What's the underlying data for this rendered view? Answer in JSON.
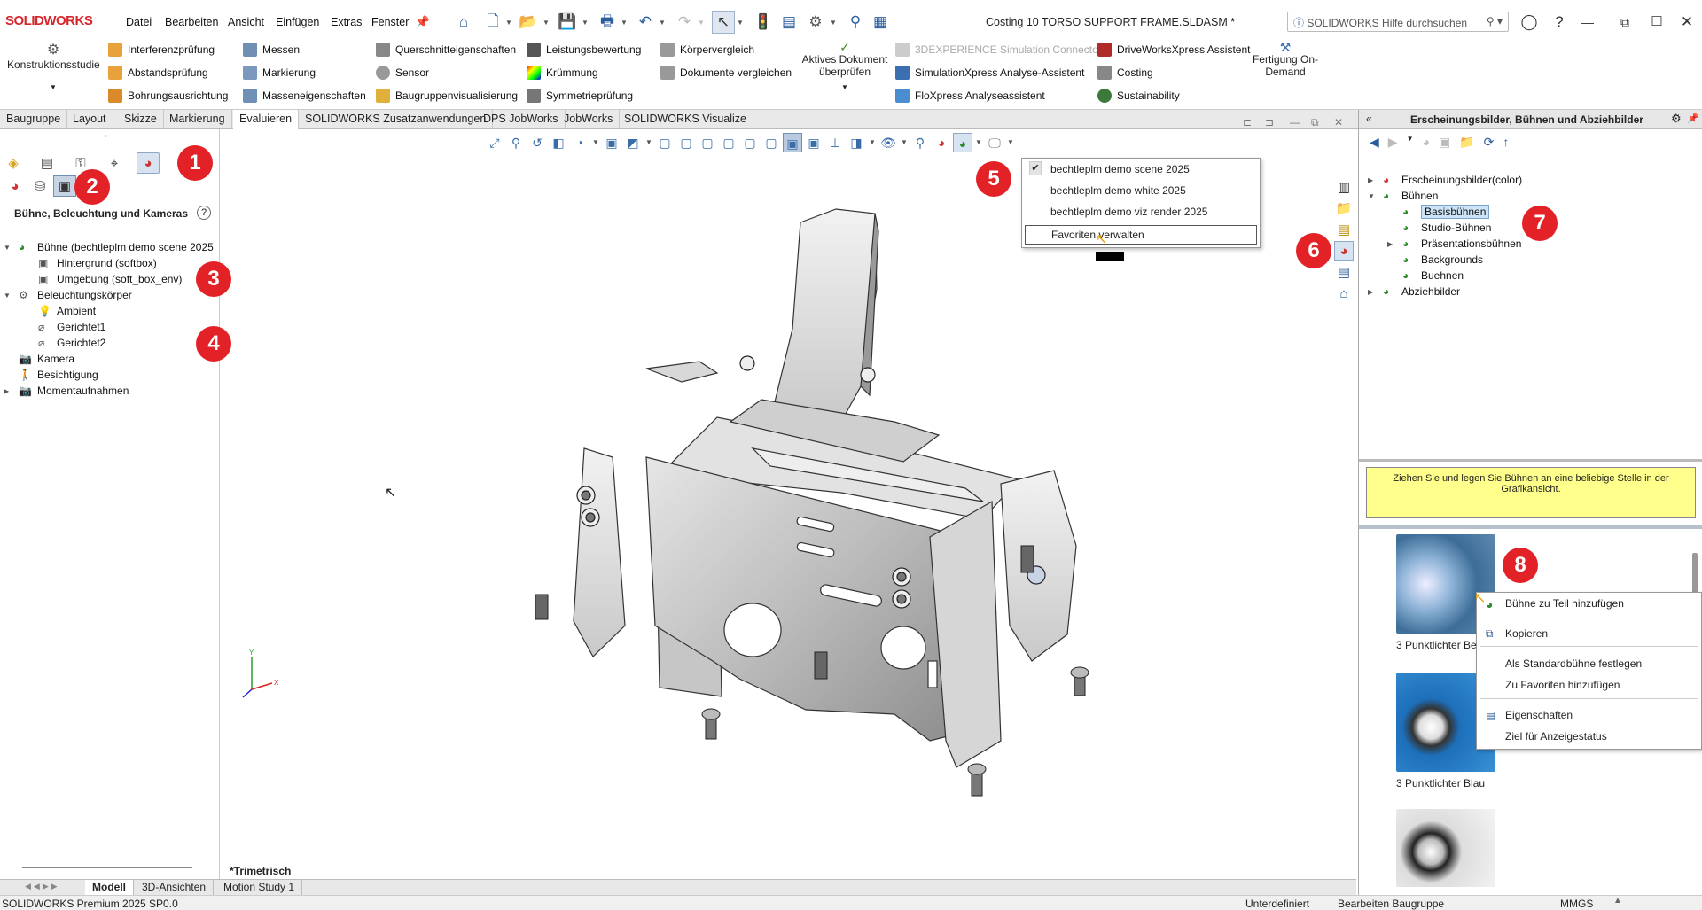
{
  "app": {
    "logo": "SOLIDWORKS",
    "doc_title": "Costing 10 TORSO SUPPORT FRAME.SLDASM *",
    "search_placeholder": "SOLIDWORKS Hilfe durchsuchen"
  },
  "menu": [
    "Datei",
    "Bearbeiten",
    "Ansicht",
    "Einfügen",
    "Extras",
    "Fenster"
  ],
  "ribbon": {
    "konstruktionsstudie": "Konstruktionsstudie",
    "col1": [
      "Interferenzprüfung",
      "Abstandsprüfung",
      "Bohrungsausrichtung"
    ],
    "col2": [
      "Messen",
      "Markierung",
      "Masseneigenschaften"
    ],
    "col3": [
      "Querschnitteigenschaften",
      "Sensor",
      "Baugruppenvisualisierung"
    ],
    "col4": [
      "Leistungsbewertung",
      "Krümmung",
      "Symmetrieprüfung"
    ],
    "col5": [
      "Körpervergleich",
      "Dokumente vergleichen"
    ],
    "aktives": "Aktives Dokument überprüfen",
    "col6": [
      "3DEXPERIENCE Simulation Connector",
      "SimulationXpress Analyse-Assistent",
      "FloXpress Analyseassistent"
    ],
    "col7": [
      "DriveWorksXpress Assistent",
      "Costing",
      "Sustainability"
    ],
    "fertigung": "Fertigung On-Demand"
  },
  "tabs": [
    "Baugruppe",
    "Layout",
    "Skizze",
    "Markierung",
    "Evaluieren",
    "SOLIDWORKS Zusatzanwendungen",
    "DPS JobWorks",
    "JobWorks",
    "SOLIDWORKS Visualize"
  ],
  "left": {
    "title": "Bühne, Beleuchtung und Kameras",
    "tree": [
      {
        "label": "Bühne (bechtleplm demo scene 2025",
        "level": 0,
        "exp": "▼",
        "icon": "scene"
      },
      {
        "label": "Hintergrund (softbox)",
        "level": 1,
        "exp": "",
        "icon": "bg"
      },
      {
        "label": "Umgebung (soft_box_env)",
        "level": 1,
        "exp": "",
        "icon": "env"
      },
      {
        "label": "Beleuchtungskörper",
        "level": 0,
        "exp": "▼",
        "icon": "lights"
      },
      {
        "label": "Ambient",
        "level": 1,
        "exp": "",
        "icon": "bulb"
      },
      {
        "label": "Gerichtet1",
        "level": 1,
        "exp": "",
        "icon": "dir"
      },
      {
        "label": "Gerichtet2",
        "level": 1,
        "exp": "",
        "icon": "dir"
      },
      {
        "label": "Kamera",
        "level": 0,
        "exp": "",
        "icon": "camera"
      },
      {
        "label": "Besichtigung",
        "level": 0,
        "exp": "",
        "icon": "walk"
      },
      {
        "label": "Momentaufnahmen",
        "level": 0,
        "exp": "▶",
        "icon": "snap"
      }
    ]
  },
  "scene_dropdown": [
    "bechtleplm demo scene 2025",
    "bechtleplm demo white 2025",
    "bechtleplm demo viz render 2025",
    "Favoriten verwalten"
  ],
  "view_label": "*Trimetrisch",
  "right": {
    "title": "Erscheinungsbilder, Bühnen und Abziehbilder",
    "tree": [
      {
        "label": "Erscheinungsbilder(color)",
        "level": 0,
        "exp": "▶"
      },
      {
        "label": "Bühnen",
        "level": 0,
        "exp": "▼"
      },
      {
        "label": "Basisbühnen",
        "level": 1,
        "exp": "",
        "selected": true
      },
      {
        "label": "Studio-Bühnen",
        "level": 1,
        "exp": ""
      },
      {
        "label": "Präsentationsbühnen",
        "level": 1,
        "exp": "▶"
      },
      {
        "label": "Backgrounds",
        "level": 1,
        "exp": ""
      },
      {
        "label": "Buehnen",
        "level": 1,
        "exp": ""
      },
      {
        "label": "Abziehbilder",
        "level": 0,
        "exp": "▶"
      }
    ],
    "hint": "Ziehen Sie und legen Sie Bühnen an eine beliebige Stelle in der Grafikansicht.",
    "thumbs": [
      "3 Punktlichter Be",
      "3 Punktlichter Blau",
      ""
    ]
  },
  "context_menu": [
    "Bühne zu Teil hinzufügen",
    "Kopieren",
    "Als Standardbühne festlegen",
    "Zu Favoriten hinzufügen",
    "Eigenschaften",
    "Ziel für Anzeigestatus"
  ],
  "bottom_tabs": [
    "Modell",
    "3D-Ansichten",
    "Motion Study 1"
  ],
  "status": {
    "left": "SOLIDWORKS Premium 2025 SP0.0",
    "s1": "Unterdefiniert",
    "s2": "Bearbeiten Baugruppe",
    "s3": "MMGS"
  },
  "badges": [
    "1",
    "2",
    "3",
    "4",
    "5",
    "6",
    "7",
    "8"
  ],
  "colors": {
    "badge": "#e32227",
    "accent": "#2b5d9a",
    "hint_bg": "#ffff8c"
  }
}
